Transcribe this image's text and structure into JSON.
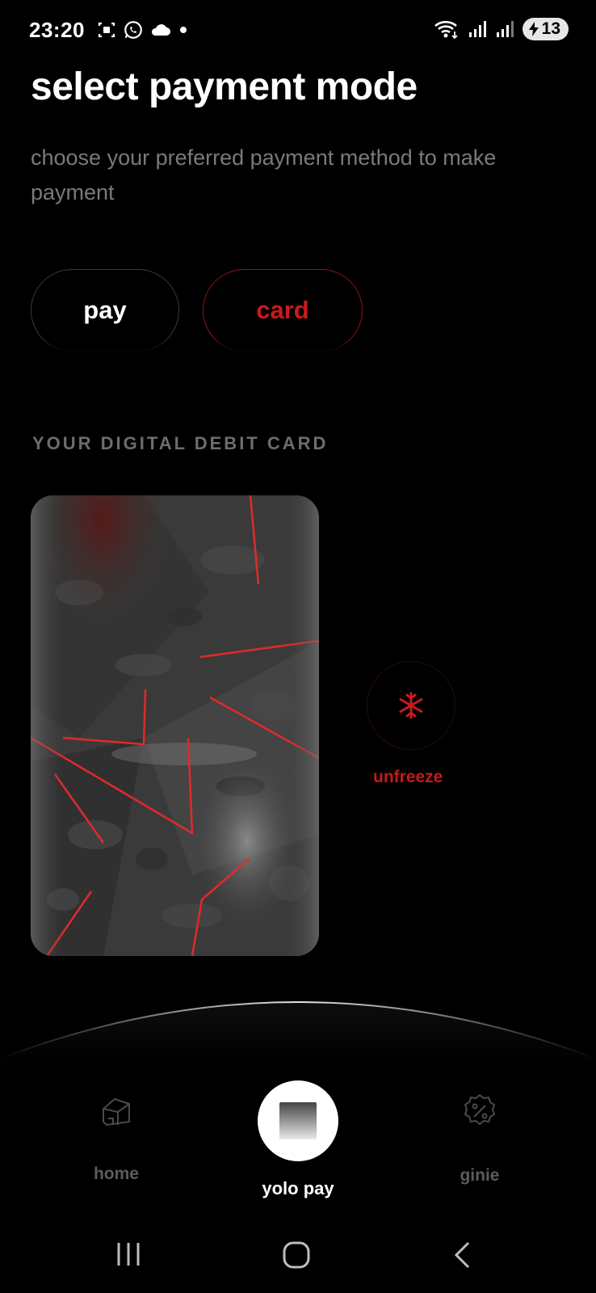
{
  "status_bar": {
    "time": "23:20",
    "left_icons": [
      "screen-record-icon",
      "whatsapp-icon",
      "cloud-icon",
      "dot-icon"
    ],
    "right_icons": [
      "wifi-icon",
      "signal-icon",
      "signal-icon"
    ],
    "battery_level": "13"
  },
  "header": {
    "title": "select payment mode",
    "subtitle": "choose your preferred payment method to make payment"
  },
  "modes": {
    "pay_label": "pay",
    "card_label": "card",
    "selected": "card"
  },
  "card_section": {
    "label": "YOUR DIGITAL DEBIT CARD",
    "freeze_icon": "snowflake-icon",
    "freeze_label": "unfreeze"
  },
  "bottom_nav": {
    "items": [
      {
        "label": "home",
        "icon": "home-icon"
      },
      {
        "label": "yolo pay",
        "icon": "square-icon"
      },
      {
        "label": "ginie",
        "icon": "discount-badge-icon"
      }
    ],
    "active": "yolo pay"
  },
  "system_nav": [
    "recent-apps-icon",
    "home-circle-icon",
    "back-icon"
  ],
  "colors": {
    "accent": "#c91b1b",
    "background": "#000000",
    "muted_text": "#7a7a7a"
  }
}
